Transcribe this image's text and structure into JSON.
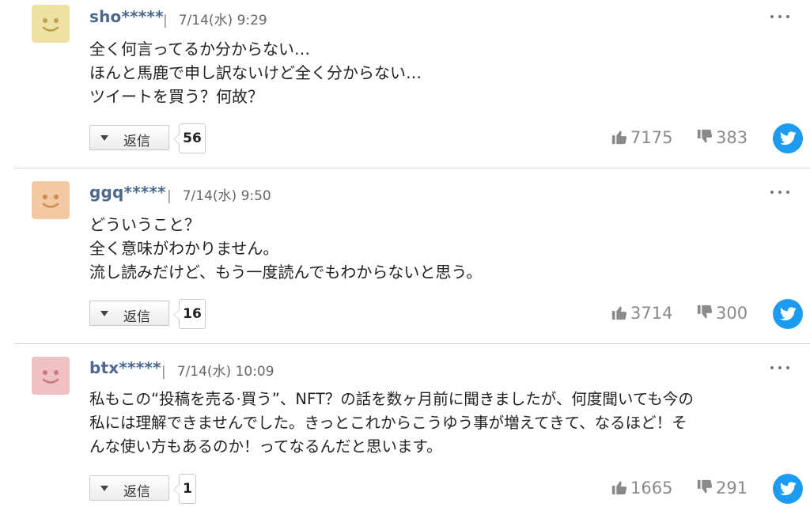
{
  "labels": {
    "reply": "返信"
  },
  "colors": {
    "avatar_yellow": "#efe0a4",
    "avatar_orange": "#f2c9a2",
    "avatar_pink": "#f0c1c3",
    "username": "#4d6890",
    "twitter": "#1d9bf0"
  },
  "comments": [
    {
      "username": "sho*****",
      "separator": "|",
      "date": "7/14(水) 9:29",
      "lines": [
        "全く何言ってるか分からない…",
        "ほんと馬鹿で申し訳ないけど全く分からない…",
        "ツイートを買う？何故？"
      ],
      "replies": "56",
      "likes": "7175",
      "dislikes": "383"
    },
    {
      "username": "ggq*****",
      "separator": "|",
      "date": "7/14(水) 9:50",
      "lines": [
        "どういうこと？",
        "全く意味がわかりません。",
        "流し読みだけど、もう一度読んでもわからないと思う。"
      ],
      "replies": "16",
      "likes": "3714",
      "dislikes": "300"
    },
    {
      "username": "btx*****",
      "separator": "|",
      "date": "7/14(水) 10:09",
      "lines": [
        "私もこの“投稿を売る·買う”、NFT？の話を数ヶ月前に聞きましたが、何度聞いても今の",
        "私には理解できませんでした。きっとこれからこうゆう事が増えてきて、なるほど！そ",
        "んな使い方もあるのか！ってなるんだと思います。"
      ],
      "replies": "1",
      "likes": "1665",
      "dislikes": "291"
    }
  ]
}
